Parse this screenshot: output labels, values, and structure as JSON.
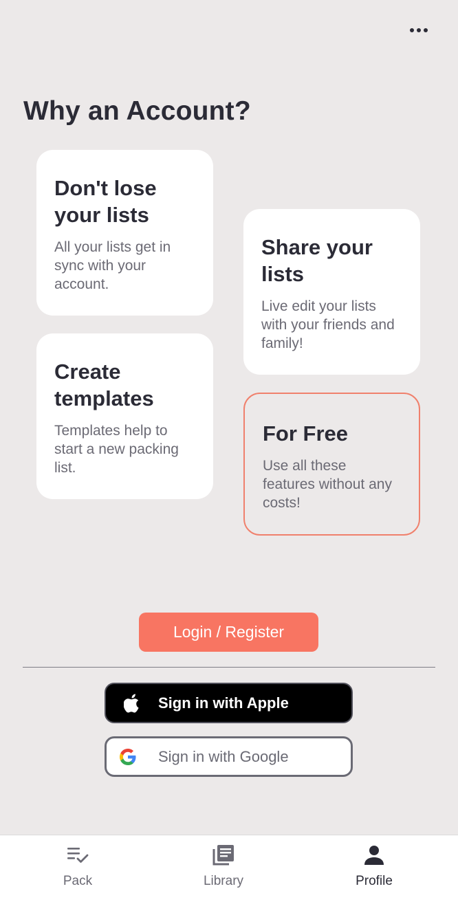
{
  "header": {
    "title": "Why an Account?",
    "more_icon": "more-horizontal-icon"
  },
  "cards": {
    "lose": {
      "title": "Don't lose your lists",
      "body": "All your lists get in sync with your account."
    },
    "share": {
      "title": "Share your lists",
      "body": "Live edit your lists with your friends and family!"
    },
    "templates": {
      "title": "Create templates",
      "body": "Templates help to start a new packing list."
    },
    "free": {
      "title": "For Free",
      "body": "Use all these features without any costs!"
    }
  },
  "auth": {
    "login_label": "Login / Register",
    "apple_label": "Sign in with Apple",
    "google_label": "Sign in with Google"
  },
  "tabs": [
    {
      "label": "Pack",
      "icon": "checklist-icon"
    },
    {
      "label": "Library",
      "icon": "library-icon"
    },
    {
      "label": "Profile",
      "icon": "person-icon",
      "active": true
    }
  ],
  "colors": {
    "background": "#ece9e9",
    "accent": "#f87562",
    "text": "#2b2b36",
    "muted_text": "#6b6a74"
  }
}
